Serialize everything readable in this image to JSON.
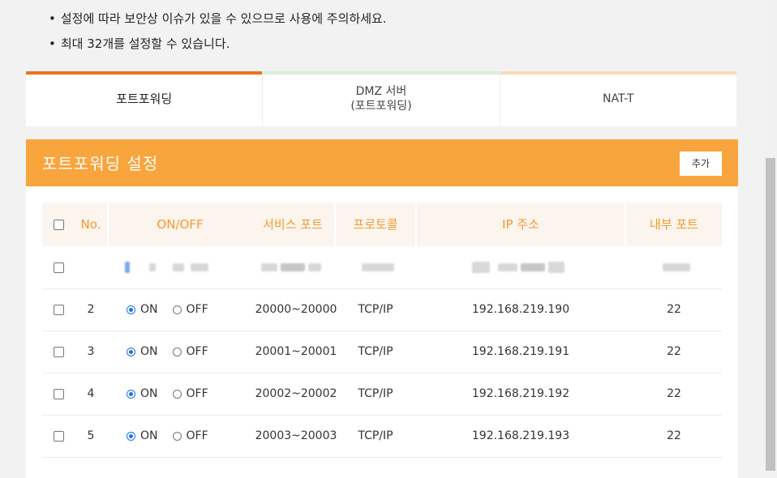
{
  "notes": [
    "설정에 따라 보안상 이슈가 있을 수 있으므로 사용에 주의하세요.",
    "최대 32개를 설정할 수 있습니다."
  ],
  "tabs": [
    {
      "label": "포트포워딩",
      "color": "#e8741a"
    },
    {
      "label": "DMZ 서버\n(포트포워딩)",
      "color": "#d9efdc"
    },
    {
      "label": "NAT-T",
      "color": "#fbd9b8"
    }
  ],
  "panel": {
    "title": "포트포워딩 설정",
    "add_label": "추가",
    "accent": "#f9a53d"
  },
  "table": {
    "headers": {
      "no": "No.",
      "onoff": "ON/OFF",
      "service_port": "서비스 포트",
      "protocol": "프로토콜",
      "ip": "IP 주소",
      "internal_port": "내부 포트"
    },
    "on_label": "ON",
    "off_label": "OFF",
    "rows": [
      {
        "no": "2",
        "state": "ON",
        "service_port": "20000~20000",
        "protocol": "TCP/IP",
        "ip": "192.168.219.190",
        "internal_port": "22"
      },
      {
        "no": "3",
        "state": "ON",
        "service_port": "20001~20001",
        "protocol": "TCP/IP",
        "ip": "192.168.219.191",
        "internal_port": "22"
      },
      {
        "no": "4",
        "state": "ON",
        "service_port": "20002~20002",
        "protocol": "TCP/IP",
        "ip": "192.168.219.192",
        "internal_port": "22"
      },
      {
        "no": "5",
        "state": "ON",
        "service_port": "20003~20003",
        "protocol": "TCP/IP",
        "ip": "192.168.219.193",
        "internal_port": "22"
      }
    ]
  }
}
